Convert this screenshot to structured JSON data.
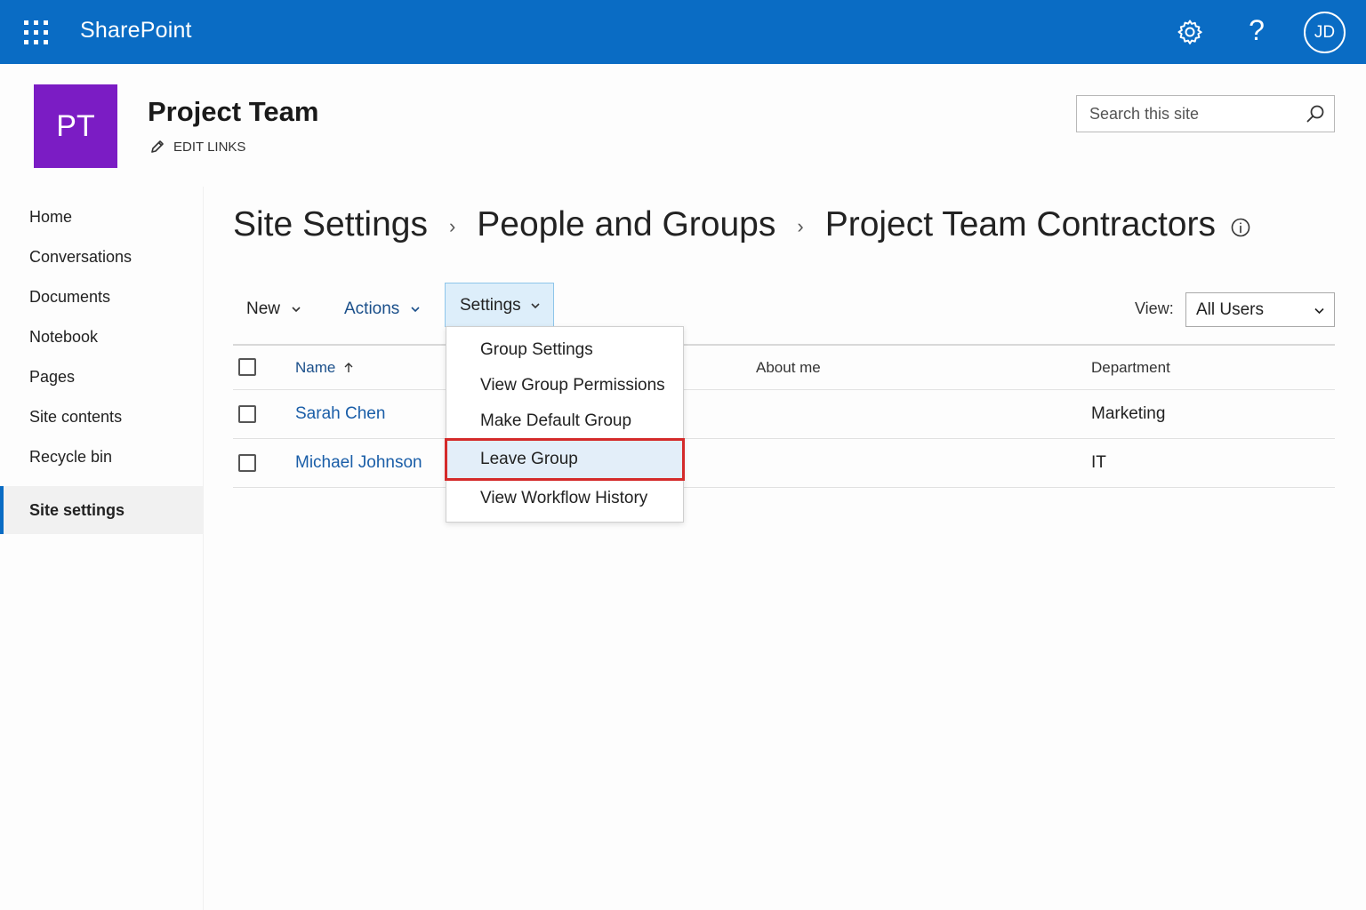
{
  "suitebar": {
    "brand": "SharePoint",
    "avatar_initials": "JD",
    "help_glyph": "?",
    "color": "#0a6cc4"
  },
  "site": {
    "logo_text": "PT",
    "logo_color": "#7b1cc4",
    "title": "Project Team",
    "edit_links": "EDIT LINKS",
    "search_placeholder": "Search this site"
  },
  "nav": {
    "items": [
      "Home",
      "Conversations",
      "Documents",
      "Notebook",
      "Pages",
      "Site contents",
      "Recycle bin"
    ],
    "active": "Site settings"
  },
  "breadcrumb": {
    "items": [
      "Site Settings",
      "People and Groups",
      "Project Team Contractors"
    ],
    "separator": "›"
  },
  "commands": {
    "new": "New",
    "actions": "Actions",
    "settings": "Settings",
    "view_label": "View:",
    "view_value": "All Users"
  },
  "table": {
    "columns": [
      "Name",
      "About me",
      "Department"
    ],
    "sort": "ascending",
    "rows": [
      {
        "name": "Sarah Chen",
        "about": "",
        "department": "Marketing"
      },
      {
        "name": "Michael Johnson",
        "about": "",
        "department": "IT"
      }
    ]
  },
  "settings_menu": {
    "items": [
      "Group Settings",
      "View Group Permissions",
      "Make Default Group",
      "Leave Group",
      "View Workflow History"
    ],
    "highlighted": "Leave Group",
    "highlight_color": "#d42a2a"
  },
  "icons": {
    "waffle": "app-launcher-icon",
    "gear": "gear-icon",
    "search": "search-icon",
    "pencil": "pencil-icon",
    "info": "info-icon",
    "chevron": "chevron-down-icon",
    "sort": "arrow-up-icon"
  }
}
